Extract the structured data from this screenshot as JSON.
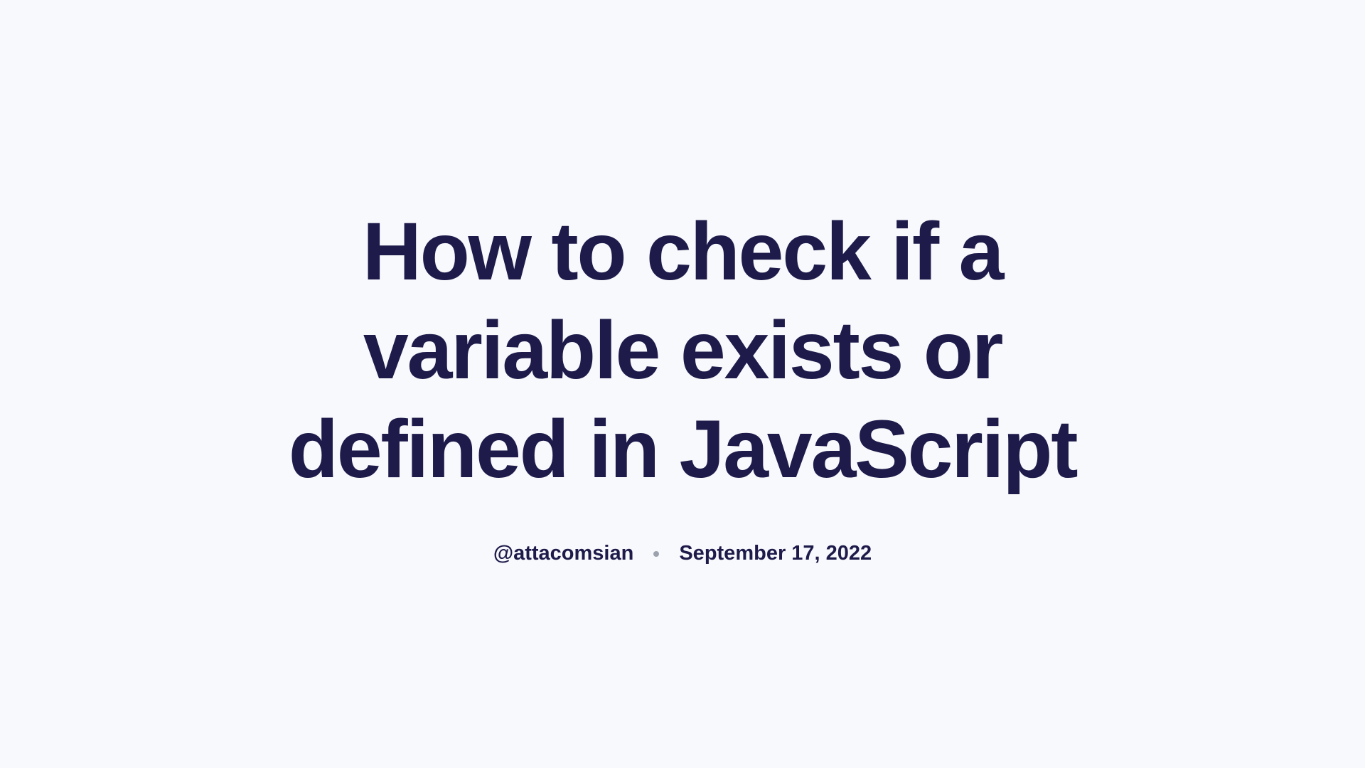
{
  "article": {
    "title": "How to check if a variable exists or defined in JavaScript",
    "author": "@attacomsian",
    "date": "September 17, 2022"
  }
}
